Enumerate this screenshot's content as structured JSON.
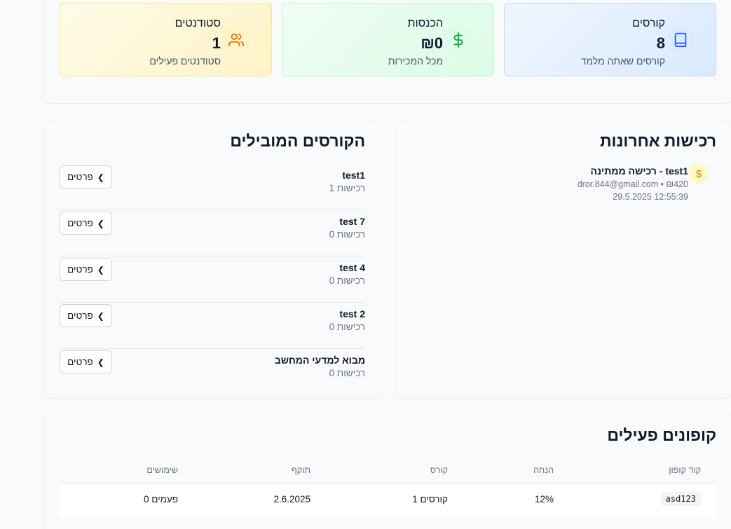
{
  "stats": {
    "courses": {
      "title": "קורסים",
      "value": "8",
      "sub": "קורסים שאתה מלמד",
      "icon": "book-icon",
      "color": "#2563eb"
    },
    "revenue": {
      "title": "הכנסות",
      "value": "₪0",
      "sub": "מכל המכירות",
      "icon": "dollar-icon",
      "color": "#16a34a"
    },
    "students": {
      "title": "סטודנטים",
      "value": "1",
      "sub": "סטודנטים פעילים",
      "icon": "users-icon",
      "color": "#d97706"
    }
  },
  "recent": {
    "heading": "רכישות אחרונות",
    "items": [
      {
        "title": "רכישה ממתינה - test1",
        "meta": "dror.844@gmail.com • ₪420",
        "time": "29.5.2025 12:55:39",
        "icon": "dollar-icon"
      }
    ]
  },
  "top_courses": {
    "heading": "הקורסים המובילים",
    "details_label": "פרטים",
    "items": [
      {
        "name": "test1",
        "enrollments": "1 רכישות"
      },
      {
        "name": "test 7",
        "enrollments": "0 רכישות"
      },
      {
        "name": "test 4",
        "enrollments": "0 רכישות"
      },
      {
        "name": "test 2",
        "enrollments": "0 רכישות"
      },
      {
        "name": "מבוא למדעי המחשב",
        "enrollments": "0 רכישות"
      }
    ]
  },
  "coupons": {
    "heading": "קופונים פעילים",
    "columns": [
      "קוד קופון",
      "הנחה",
      "קורס",
      "תוקף",
      "שימושים"
    ],
    "rows": [
      {
        "code": "asd123",
        "discount": "12%",
        "course": "1 קורסים",
        "validity": "2.6.2025",
        "uses": "0 פעמים"
      }
    ]
  },
  "colors": {
    "accent_blue": "#2563eb",
    "accent_green": "#16a34a",
    "accent_amber": "#d97706",
    "page_bg": "#f8fafc"
  }
}
